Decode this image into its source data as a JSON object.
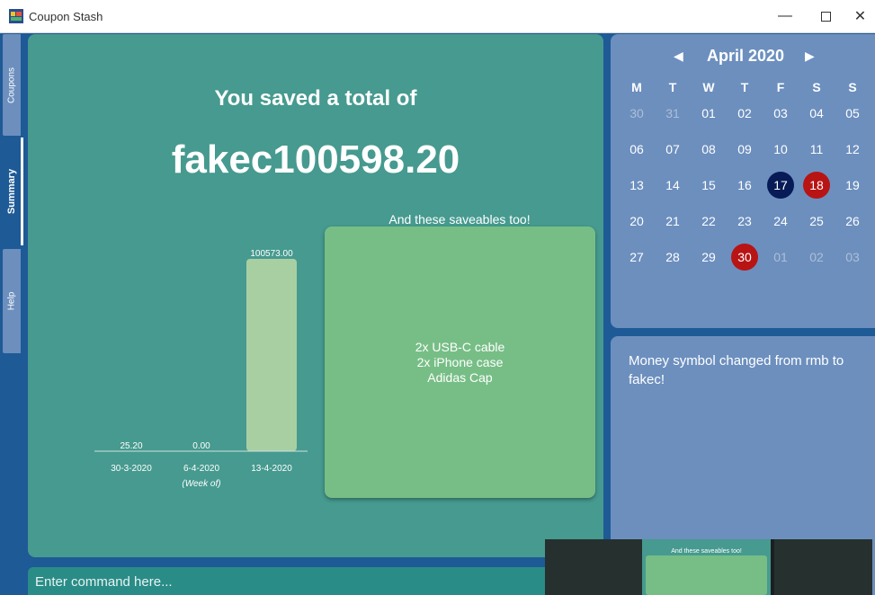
{
  "window": {
    "title": "Coupon Stash"
  },
  "tabs": [
    {
      "label": "Coupons"
    },
    {
      "label": "Summary"
    },
    {
      "label": "Help"
    }
  ],
  "summary": {
    "title": "You saved a total of",
    "amount": "fakec100598.20",
    "x_axis_note": "(Week of)",
    "saveables_title": "And these saveables too!",
    "saveables": [
      "2x USB-C cable",
      "2x iPhone case",
      "Adidas Cap"
    ]
  },
  "chart_data": {
    "type": "bar",
    "categories": [
      "30-3-2020",
      "6-4-2020",
      "13-4-2020"
    ],
    "values": [
      25.2,
      0.0,
      100573.0
    ],
    "value_labels": [
      "25.20",
      "0.00",
      "100573.00"
    ],
    "title": "",
    "xlabel": "(Week of)",
    "ylabel": "",
    "ylim": [
      0,
      100573
    ]
  },
  "calendar": {
    "month": "April 2020",
    "prev_icon": "◀",
    "next_icon": "▶",
    "weekdays": [
      "M",
      "T",
      "W",
      "T",
      "F",
      "S",
      "S"
    ],
    "weeks": [
      [
        {
          "d": "30",
          "state": "other"
        },
        {
          "d": "31",
          "state": "other"
        },
        {
          "d": "01",
          "state": ""
        },
        {
          "d": "02",
          "state": ""
        },
        {
          "d": "03",
          "state": ""
        },
        {
          "d": "04",
          "state": ""
        },
        {
          "d": "05",
          "state": ""
        }
      ],
      [
        {
          "d": "06",
          "state": ""
        },
        {
          "d": "07",
          "state": ""
        },
        {
          "d": "08",
          "state": ""
        },
        {
          "d": "09",
          "state": ""
        },
        {
          "d": "10",
          "state": ""
        },
        {
          "d": "11",
          "state": ""
        },
        {
          "d": "12",
          "state": ""
        }
      ],
      [
        {
          "d": "13",
          "state": ""
        },
        {
          "d": "14",
          "state": ""
        },
        {
          "d": "15",
          "state": ""
        },
        {
          "d": "16",
          "state": ""
        },
        {
          "d": "17",
          "state": "navy"
        },
        {
          "d": "18",
          "state": "red"
        },
        {
          "d": "19",
          "state": ""
        }
      ],
      [
        {
          "d": "20",
          "state": ""
        },
        {
          "d": "21",
          "state": ""
        },
        {
          "d": "22",
          "state": ""
        },
        {
          "d": "23",
          "state": ""
        },
        {
          "d": "24",
          "state": ""
        },
        {
          "d": "25",
          "state": ""
        },
        {
          "d": "26",
          "state": ""
        }
      ],
      [
        {
          "d": "27",
          "state": ""
        },
        {
          "d": "28",
          "state": ""
        },
        {
          "d": "29",
          "state": ""
        },
        {
          "d": "30",
          "state": "red"
        },
        {
          "d": "01",
          "state": "other"
        },
        {
          "d": "02",
          "state": "other"
        },
        {
          "d": "03",
          "state": "other"
        }
      ]
    ]
  },
  "message": {
    "text": "Money symbol changed from rmb to fakec!"
  },
  "command": {
    "placeholder": "Enter command here..."
  },
  "preview": {
    "title": "And these saveables too!"
  },
  "colors": {
    "main_panel": "#469a8f",
    "bar": "#a8cfa2",
    "saveables_box": "#77be86",
    "side_panel": "#6c8fbe",
    "navy_date": "#071b57",
    "red_date": "#b81414"
  }
}
